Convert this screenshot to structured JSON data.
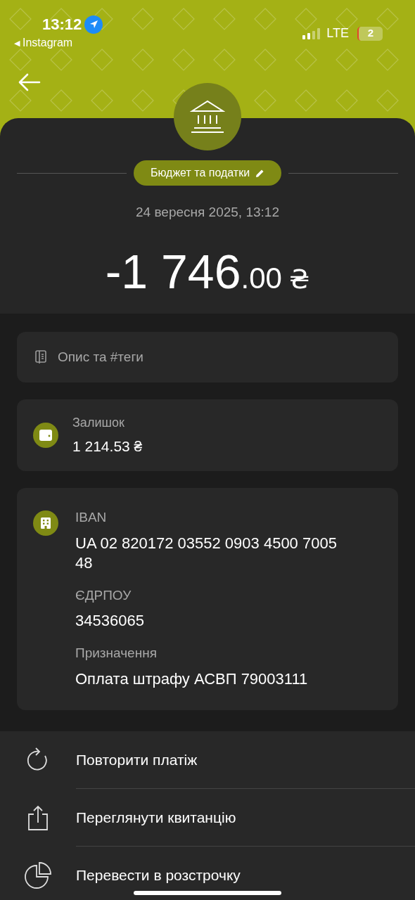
{
  "status_bar": {
    "time": "13:12",
    "back_glyph": "◀",
    "back_app": "Instagram",
    "network": "LTE",
    "battery": "2"
  },
  "header": {
    "category": "Бюджет та податки",
    "date": "24 вересня 2025, 13:12",
    "amount": "-1 746",
    "amount_cents": ".00",
    "currency": "₴"
  },
  "description": {
    "placeholder": "Опис та #теги"
  },
  "balance": {
    "label": "Залишок",
    "value": "1 214.53 ₴"
  },
  "details": [
    {
      "label": "IBAN",
      "value": "UA 02 820172 03552 0903 4500 7005 48"
    },
    {
      "label": "ЄДРПОУ",
      "value": "34536065"
    },
    {
      "label": "Призначення",
      "value": "Оплата штрафу АСВП 79003111"
    }
  ],
  "actions": [
    {
      "kind": "repeat",
      "label": "Повторити платіж"
    },
    {
      "kind": "receipt",
      "label": "Переглянути квитанцію"
    },
    {
      "kind": "installment",
      "label": "Перевести в розстрочку"
    }
  ]
}
